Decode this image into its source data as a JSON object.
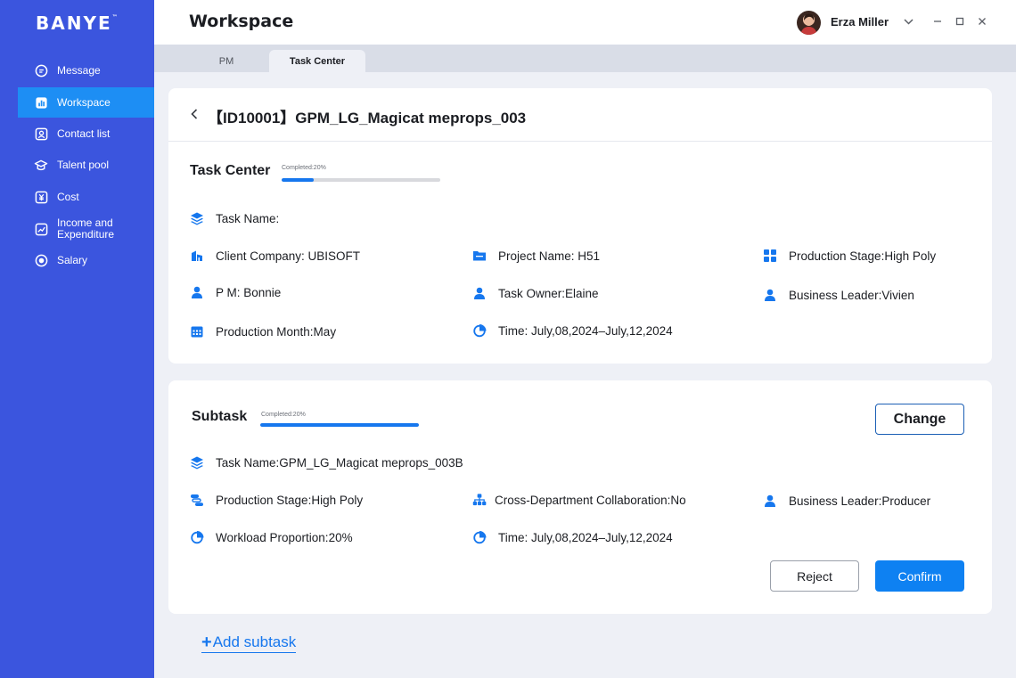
{
  "app": {
    "logo": "BANYE",
    "logo_tm": "™"
  },
  "sidebar": {
    "items": [
      {
        "label": "Message",
        "icon": "message-icon"
      },
      {
        "label": "Workspace",
        "icon": "chart-icon",
        "active": true
      },
      {
        "label": "Contact list",
        "icon": "contact-icon"
      },
      {
        "label": "Talent pool",
        "icon": "graduation-cap-icon"
      },
      {
        "label": "Cost",
        "icon": "cost-icon"
      },
      {
        "label": "Income and Expenditure",
        "icon": "trend-icon"
      },
      {
        "label": "Salary",
        "icon": "salary-icon"
      }
    ]
  },
  "header": {
    "title": "Workspace",
    "user_name": "Erza Miller"
  },
  "tabs": [
    {
      "label": "PM"
    },
    {
      "label": "Task Center",
      "active": true
    }
  ],
  "task": {
    "title": "【ID10001】GPM_LG_Magicat meprops_003",
    "section_title": "Task Center",
    "progress_label": "Completed:20%",
    "progress": 0.2,
    "fields": {
      "task_name": "Task Name:",
      "client_company": "Client Company: UBISOFT",
      "project_name": "Project Name: H51",
      "production_stage": "Production Stage:High Poly",
      "pm": "P M: Bonnie",
      "task_owner": "Task Owner:Elaine",
      "business_leader": "Business Leader:Vivien",
      "production_month": "Production Month:May",
      "time": "Time: July,08,2024–July,12,2024"
    }
  },
  "subtask": {
    "section_title": "Subtask",
    "progress_label": "Completed:20%",
    "progress": 1.0,
    "change_label": "Change",
    "fields": {
      "task_name": "Task Name:GPM_LG_Magicat meprops_003B",
      "production_stage": "Production Stage:High Poly",
      "cross_department": "Cross-Department Collaboration:No",
      "business_leader": "Business Leader:Producer",
      "workload": "Workload Proportion:20%",
      "time": "Time: July,08,2024–July,12,2024"
    },
    "reject_label": "Reject",
    "confirm_label": "Confirm"
  },
  "add_subtask": {
    "plus": "+",
    "label": "Add subtask"
  },
  "colors": {
    "sidebar": "#3b55de",
    "active_nav": "#1d8ef4",
    "accent": "#1677ee",
    "confirm": "#0e81f2"
  }
}
